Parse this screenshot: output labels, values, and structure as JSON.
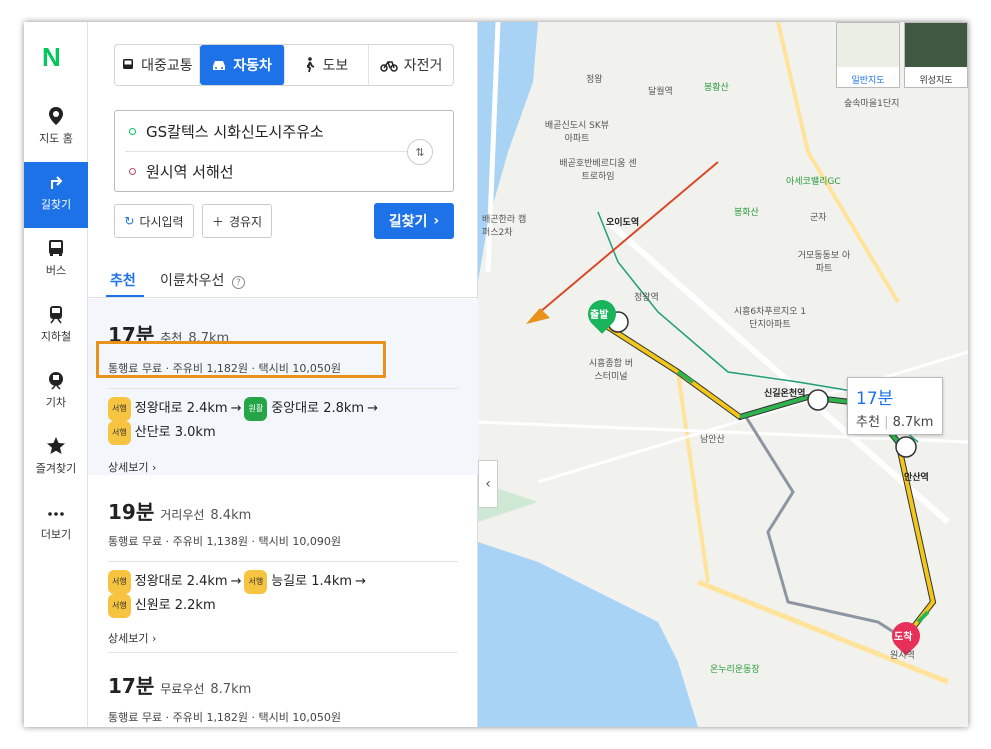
{
  "nav": {
    "logo": "N",
    "items": [
      {
        "label": "지도 홈",
        "icon": "map-pin-icon"
      },
      {
        "label": "길찾기",
        "icon": "directions-icon",
        "active": true
      },
      {
        "label": "버스",
        "icon": "bus-icon"
      },
      {
        "label": "지하철",
        "icon": "subway-icon"
      },
      {
        "label": "기차",
        "icon": "train-icon"
      },
      {
        "label": "즐겨찾기",
        "icon": "star-icon"
      },
      {
        "label": "더보기",
        "icon": "more-icon"
      }
    ]
  },
  "mode_tabs": [
    {
      "label": "대중교통",
      "icon": "bus-icon"
    },
    {
      "label": "자동차",
      "icon": "car-icon",
      "active": true
    },
    {
      "label": "도보",
      "icon": "walk-icon"
    },
    {
      "label": "자전거",
      "icon": "bike-icon"
    }
  ],
  "route": {
    "origin": "GS칼텍스 시화신도시주유소",
    "destination": "원시역 서해선",
    "swap_icon": "swap-icon"
  },
  "buttons": {
    "reset": "다시입력",
    "waypoint": "경유지",
    "search": "길찾기"
  },
  "sort_tabs": {
    "recommended": "추천",
    "eco": "이륜차우선"
  },
  "results": [
    {
      "time": "17분",
      "tag": "추천",
      "dist": "8.7km",
      "fee": "통행료 무료 · 주유비 1,182원 · 택시비 10,050원",
      "roads": [
        {
          "badge": "서행",
          "bt": "y",
          "road": "정왕대로 2.4km"
        },
        {
          "badge": "원활",
          "bt": "g",
          "road": "중앙대로 2.8km"
        },
        {
          "badge": "서행",
          "bt": "y",
          "road": "산단로 3.0km"
        }
      ],
      "detail": "상세보기"
    },
    {
      "time": "19분",
      "tag": "거리우선",
      "dist": "8.4km",
      "fee": "통행료 무료 · 주유비 1,138원 · 택시비 10,090원",
      "roads": [
        {
          "badge": "서행",
          "bt": "y",
          "road": "정왕대로 2.4km"
        },
        {
          "badge": "서행",
          "bt": "y",
          "road": "능길로 1.4km"
        },
        {
          "badge": "서행",
          "bt": "y",
          "road": "신원로 2.2km"
        }
      ],
      "detail": "상세보기"
    },
    {
      "time": "17분",
      "tag": "무료우선",
      "dist": "8.7km",
      "fee": "통행료 무료 · 주유비 1,182원 · 택시비 10,050원"
    }
  ],
  "map": {
    "popup_time": "17분",
    "popup_tag": "추천",
    "popup_dist": "8.7km",
    "start_label": "출발",
    "end_label": "도착",
    "map_type_normal": "일반지도",
    "map_type_sat": "위성지도",
    "labels": [
      "정왕",
      "달월역",
      "봉황산",
      "배곧신도시 SK뷰아파트",
      "배곧호반베르디움 센트로하임",
      "아세코밸리GC",
      "봉화산",
      "오이도역",
      "군자",
      "거모동동보 아파트",
      "배곤한라 캠퍼스2차",
      "정왕역",
      "시흥6차푸르지오 1단지아파트",
      "시흥종합 버스터미널",
      "신길온천역",
      "남안산",
      "안산역",
      "온누리운동장",
      "원시역",
      "숲속마을1단지"
    ]
  }
}
